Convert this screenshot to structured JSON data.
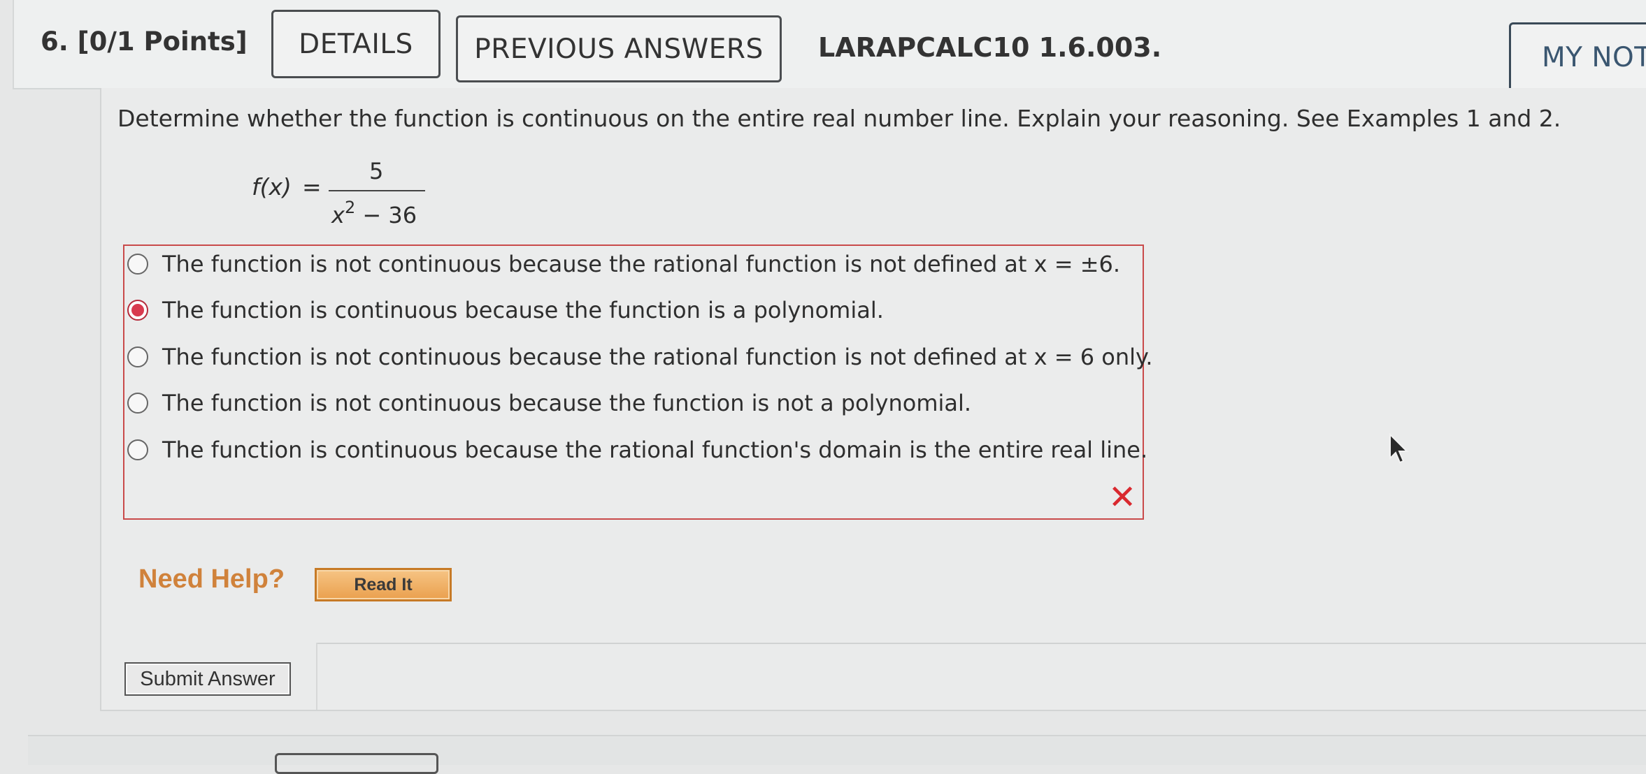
{
  "header": {
    "question_number": "6. [0/1 Points]",
    "details_label": "DETAILS",
    "previous_answers_label": "PREVIOUS ANSWERS",
    "question_id": "LARAPCALC10 1.6.003.",
    "my_notes_label": "MY NOT"
  },
  "question": {
    "prompt": "Determine whether the function is continuous on the entire real number line. Explain your reasoning. See Examples 1 and 2.",
    "function_lhs": "f(x)",
    "equals": "=",
    "numerator": "5",
    "denominator_base": "x",
    "denominator_exponent": "2",
    "denominator_rest": " − 36"
  },
  "options": [
    {
      "text": "The function is not continuous because the rational function is not defined at x = ±6.",
      "selected": false
    },
    {
      "text": "The function is continuous because the function is a polynomial.",
      "selected": true
    },
    {
      "text": "The function is not continuous because the rational function is not defined at x = 6 only.",
      "selected": false
    },
    {
      "text": "The function is not continuous because the function is not a polynomial.",
      "selected": false
    },
    {
      "text": "The function is continuous because the rational function's domain is the entire real line.",
      "selected": false
    }
  ],
  "result_mark": "✕",
  "help": {
    "label": "Need Help?",
    "read_it_label": "Read It"
  },
  "submit_label": "Submit Answer",
  "colors": {
    "wrong": "#d9292f",
    "selected_radio": "#d83a4e",
    "help_orange": "#d0823b"
  }
}
